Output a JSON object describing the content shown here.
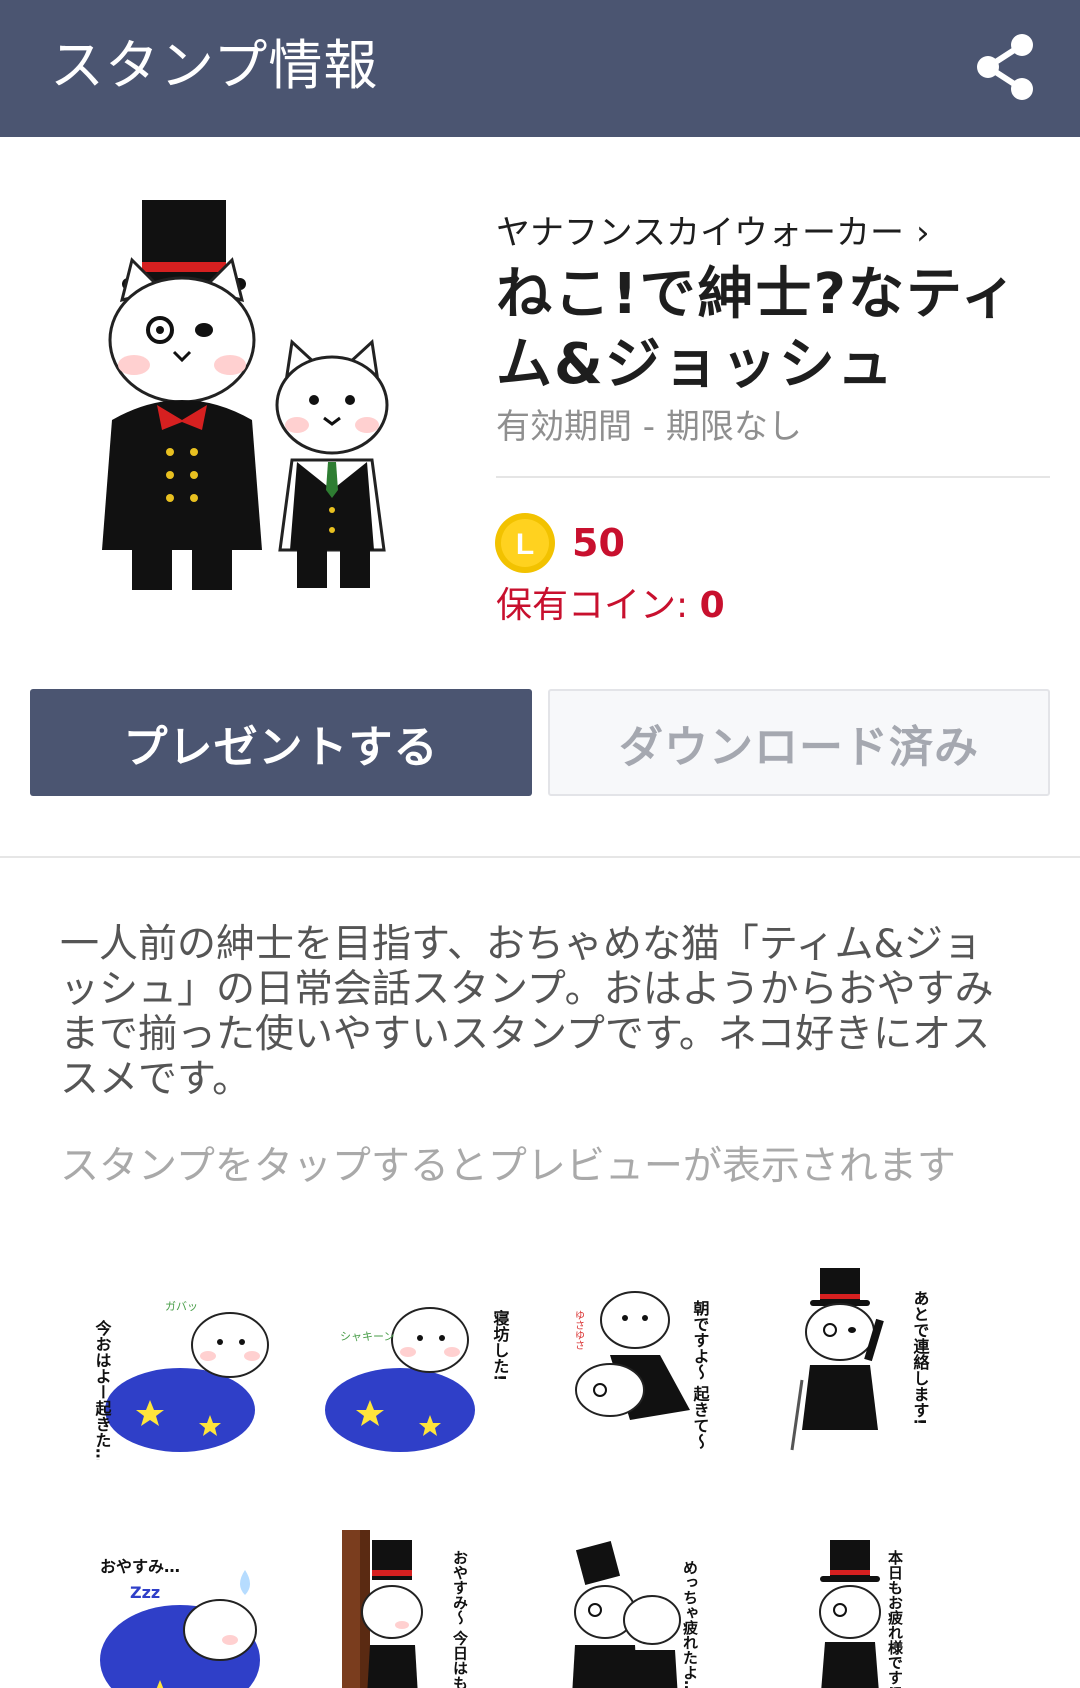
{
  "header": {
    "title": "スタンプ情報",
    "share_icon": "share-icon",
    "background": "#4b5571"
  },
  "product": {
    "author": "ヤナフンスカイウォーカー",
    "author_chevron": "›",
    "title": "ねこ!で紳士?なティム&ジョッシュ",
    "validity": "有効期間 - 期限なし",
    "coin_icon_letter": "L",
    "price": "50",
    "owned_label": "保有コイン:",
    "owned_value": "0",
    "price_color": "#c8102e"
  },
  "actions": {
    "present_label": "プレゼントする",
    "download_label": "ダウンロード済み"
  },
  "description": "一人前の紳士を目指す、おちゃめな猫「ティム&ジョッシュ」の日常会話スタンプ。おはようからおやすみまで揃った使いやすいスタンプです。ネコ好きにオススメです。",
  "preview_hint": "スタンプをタップするとプレビューが表示されます",
  "stickers": [
    {
      "text": "今おはよー起きた…",
      "sfx": "ガバッ"
    },
    {
      "text": "寝坊した!",
      "sfx": "シャキーン"
    },
    {
      "text": "朝ですよ〜 起きて〜",
      "sfx": "ゆさゆさ"
    },
    {
      "text": "あとで連絡します!"
    },
    {
      "text": "おやすみ…",
      "sfx": "Zzz"
    },
    {
      "text": "おやすみ〜 今日はもう寝るね…"
    },
    {
      "text": "めっちゃ疲れたよ…"
    },
    {
      "text": "本日もお疲れ様です!"
    }
  ]
}
